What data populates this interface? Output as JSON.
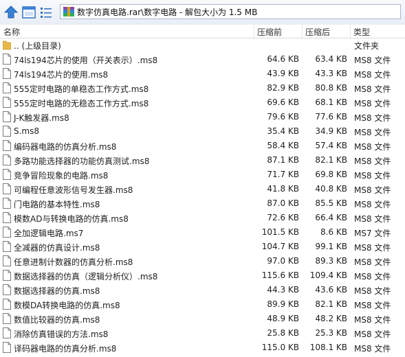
{
  "toolbar": {
    "address": "数字仿真电路.rar\\数字电路 - 解包大小为 1.5 MB"
  },
  "columns": {
    "name": "名称",
    "size": "压缩前",
    "packed": "压缩后",
    "type": "类型"
  },
  "parent_row": {
    "name": ".. (上级目录)",
    "type": "文件夹"
  },
  "rows": [
    {
      "name": "74ls194芯片的使用（开关表示）.ms8",
      "size": "64.6 KB",
      "packed": "63.4 KB",
      "type": "MS8 文件"
    },
    {
      "name": "74ls194芯片的使用.ms8",
      "size": "43.9 KB",
      "packed": "43.3 KB",
      "type": "MS8 文件"
    },
    {
      "name": "555定时电路的单稳态工作方式.ms8",
      "size": "82.9 KB",
      "packed": "80.8 KB",
      "type": "MS8 文件"
    },
    {
      "name": "555定时电路的无稳态工作方式.ms8",
      "size": "69.6 KB",
      "packed": "68.1 KB",
      "type": "MS8 文件"
    },
    {
      "name": "J-K触发器.ms8",
      "size": "79.6 KB",
      "packed": "77.6 KB",
      "type": "MS8 文件"
    },
    {
      "name": "S.ms8",
      "size": "35.4 KB",
      "packed": "34.9 KB",
      "type": "MS8 文件"
    },
    {
      "name": "编码器电路的仿真分析.ms8",
      "size": "58.4 KB",
      "packed": "57.4 KB",
      "type": "MS8 文件"
    },
    {
      "name": "多路功能选择器的功能仿真测试.ms8",
      "size": "87.1 KB",
      "packed": "82.1 KB",
      "type": "MS8 文件"
    },
    {
      "name": "竞争冒险现象的电路.ms8",
      "size": "71.7 KB",
      "packed": "69.8 KB",
      "type": "MS8 文件"
    },
    {
      "name": "可编程任意波形信号发生器.ms8",
      "size": "41.8 KB",
      "packed": "40.8 KB",
      "type": "MS8 文件"
    },
    {
      "name": "门电路的基本特性.ms8",
      "size": "87.0 KB",
      "packed": "85.5 KB",
      "type": "MS8 文件"
    },
    {
      "name": "模数AD与转换电路的仿真.ms8",
      "size": "72.6 KB",
      "packed": "66.4 KB",
      "type": "MS8 文件"
    },
    {
      "name": "全加逻辑电路.ms7",
      "size": "101.5 KB",
      "packed": "8.6 KB",
      "type": "MS7 文件"
    },
    {
      "name": "全减器的仿真设计.ms8",
      "size": "104.7 KB",
      "packed": "99.1 KB",
      "type": "MS8 文件"
    },
    {
      "name": "任意进制计数器的仿真分析.ms8",
      "size": "97.0 KB",
      "packed": "89.3 KB",
      "type": "MS8 文件"
    },
    {
      "name": "数据选择器的仿真（逻辑分析仪）.ms8",
      "size": "115.6 KB",
      "packed": "109.4 KB",
      "type": "MS8 文件"
    },
    {
      "name": "数据选择器的仿真.ms8",
      "size": "44.3 KB",
      "packed": "43.6 KB",
      "type": "MS8 文件"
    },
    {
      "name": "数模DA转换电路的仿真.ms8",
      "size": "89.9 KB",
      "packed": "82.1 KB",
      "type": "MS8 文件"
    },
    {
      "name": "数值比较器的仿真.ms8",
      "size": "48.9 KB",
      "packed": "48.2 KB",
      "type": "MS8 文件"
    },
    {
      "name": "消除仿真错误的方法.ms8",
      "size": "25.8 KB",
      "packed": "25.3 KB",
      "type": "MS8 文件"
    },
    {
      "name": "译码器电路的仿真分析.ms8",
      "size": "115.0 KB",
      "packed": "108.1 KB",
      "type": "MS8 文件"
    }
  ]
}
